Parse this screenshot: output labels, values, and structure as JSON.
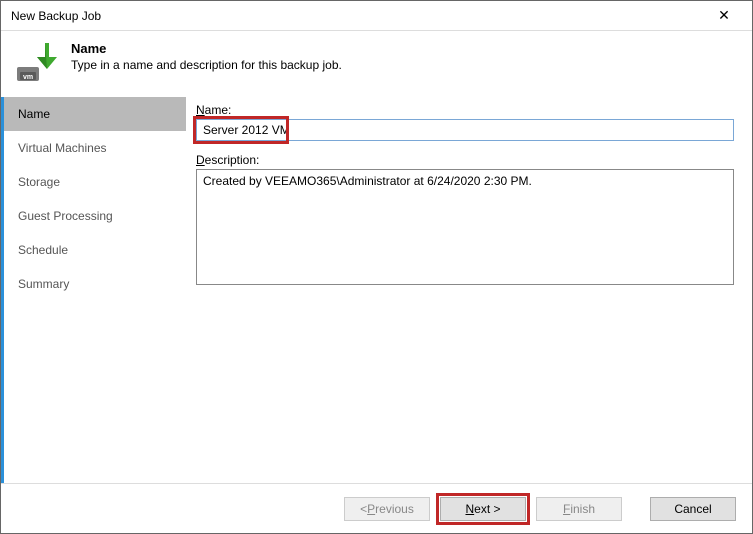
{
  "window": {
    "title": "New Backup Job"
  },
  "header": {
    "step_name": "Name",
    "step_desc": "Type in a name and description for this backup job."
  },
  "sidebar": {
    "items": [
      {
        "label": "Name",
        "active": true
      },
      {
        "label": "Virtual Machines",
        "active": false
      },
      {
        "label": "Storage",
        "active": false
      },
      {
        "label": "Guest Processing",
        "active": false
      },
      {
        "label": "Schedule",
        "active": false
      },
      {
        "label": "Summary",
        "active": false
      }
    ]
  },
  "form": {
    "name_label_prefix": "N",
    "name_label_rest": "ame:",
    "name_value": "Server 2012 VM",
    "desc_label_prefix": "D",
    "desc_label_rest": "escription:",
    "desc_value": "Created by VEEAMO365\\Administrator at 6/24/2020 2:30 PM."
  },
  "buttons": {
    "previous_prefix": "< ",
    "previous_u": "P",
    "previous_rest": "revious",
    "next_u": "N",
    "next_rest": "ext >",
    "finish_u": "F",
    "finish_rest": "inish",
    "cancel": "Cancel"
  },
  "icons": {
    "close": "✕"
  }
}
